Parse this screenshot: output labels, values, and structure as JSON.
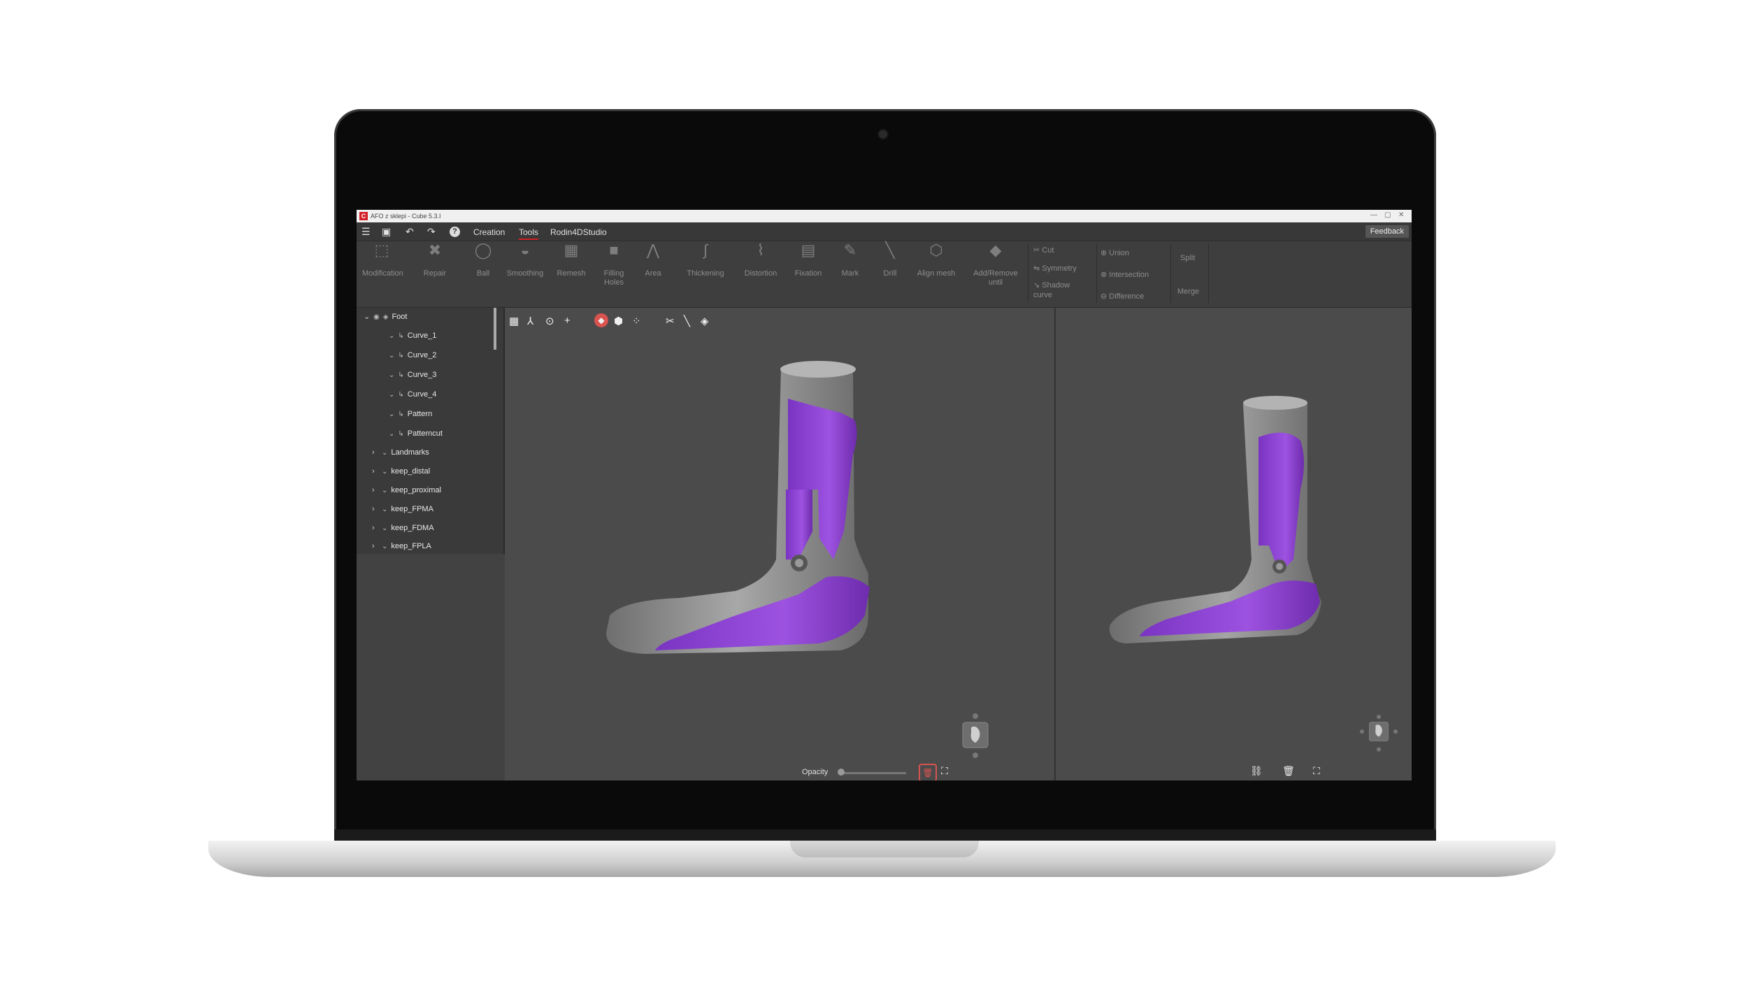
{
  "window": {
    "title": "AFO z sklepi - Cube 5.3.I",
    "logo": "C"
  },
  "menubar": {
    "icons": [
      "hamburger-menu-icon",
      "save-icon",
      "undo-icon",
      "redo-icon",
      "help-icon"
    ],
    "tabs": [
      {
        "label": "Creation"
      },
      {
        "label": "Tools",
        "active": true
      },
      {
        "label": "Rodin4DStudio"
      }
    ],
    "feedback": "Feedback"
  },
  "ribbon": {
    "tools": [
      {
        "label": "Modification"
      },
      {
        "label": "Repair"
      },
      {
        "label": "Ball"
      },
      {
        "label": "Smoothing"
      },
      {
        "label": "Remesh"
      },
      {
        "label": "Filling\nHoles"
      },
      {
        "label": "Area"
      },
      {
        "label": "Thickening"
      },
      {
        "label": "Distortion"
      },
      {
        "label": "Fixation"
      },
      {
        "label": "Mark"
      },
      {
        "label": "Drill"
      },
      {
        "label": "Align mesh"
      },
      {
        "label": "Add/Remove\nuntil"
      }
    ],
    "cut_tools": [
      {
        "label": "Cut"
      },
      {
        "label": "Symmetry"
      },
      {
        "label": "Shadow\ncurve"
      }
    ],
    "boolean_tools": [
      {
        "label": "Union"
      },
      {
        "label": "Intersection"
      },
      {
        "label": "Difference"
      }
    ],
    "split_merge": [
      {
        "label": "Split"
      },
      {
        "label": "Merge"
      }
    ]
  },
  "tree": {
    "root": "Foot",
    "children": [
      "Curve_1",
      "Curve_2",
      "Curve_3",
      "Curve_4",
      "Pattern",
      "Patterncut"
    ],
    "groups": [
      "Landmarks",
      "keep_distal",
      "keep_proximal",
      "keep_FPMA",
      "keep_FDMA",
      "keep_FPLA"
    ]
  },
  "viewport": {
    "opacity_label": "Opacity",
    "accent": "#d21f26",
    "model_colors": {
      "brace": "#8a3fd0",
      "leg": "#8c8c8c"
    }
  }
}
